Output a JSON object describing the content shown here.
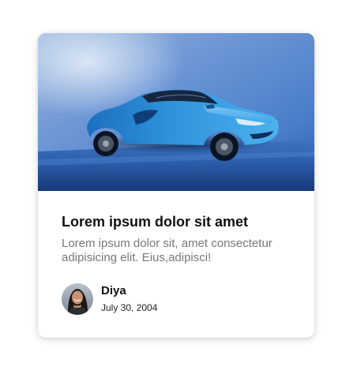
{
  "card": {
    "image_subject": "blue sports car",
    "title": "Lorem ipsum dolor sit amet",
    "description": "Lorem ipsum dolor sit, amet consectetur adipisicing elit. Eius,adipisci!",
    "author": {
      "name": "Diya",
      "date": "July 30, 2004",
      "avatar_subject": "user photo"
    }
  },
  "colors": {
    "title": "#111111",
    "description": "#777777",
    "car_body": "#2f8fd8",
    "background_blue": "#5f8fd0"
  }
}
